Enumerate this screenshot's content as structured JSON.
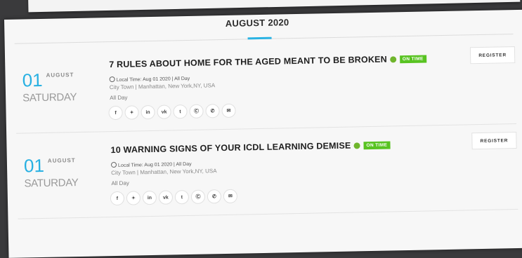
{
  "calendar": {
    "month_heading": "AUGUST 2020",
    "events": [
      {
        "date_number": "01",
        "date_month": "AUGUST",
        "date_weekday": "SATURDAY",
        "title": "7 RULES ABOUT HOME FOR THE AGED MEANT TO BE BROKEN",
        "status_badge": "ON TIME",
        "time_label": "Local Time: Aug 01 2020",
        "time_separator": "|",
        "time_value": "All Day",
        "location": "City Town | Manhattan, New York,NY, USA",
        "all_day": "All Day",
        "register_label": "REGISTER"
      },
      {
        "date_number": "01",
        "date_month": "AUGUST",
        "date_weekday": "SATURDAY",
        "title": "10 WARNING SIGNS OF YOUR ICDL LEARNING DEMISE",
        "status_badge": "ON TIME",
        "time_label": "Local Time: Aug 01 2020",
        "time_separator": "|",
        "time_value": "All Day",
        "location": "City Town | Manhattan, New York,NY, USA",
        "all_day": "All Day",
        "register_label": "REGISTER"
      }
    ],
    "share_icons": [
      "f",
      "✦",
      "in",
      "vk",
      "t",
      "Ⓒ",
      "✆",
      "✉"
    ],
    "share_icon_names": [
      "facebook-icon",
      "twitter-icon",
      "linkedin-icon",
      "vk-icon",
      "tumblr-icon",
      "reddit-icon",
      "whatsapp-icon",
      "email-icon"
    ]
  },
  "colors": {
    "accent": "#27b0e2",
    "badge": "#58c321",
    "dot": "#6fb52c"
  }
}
